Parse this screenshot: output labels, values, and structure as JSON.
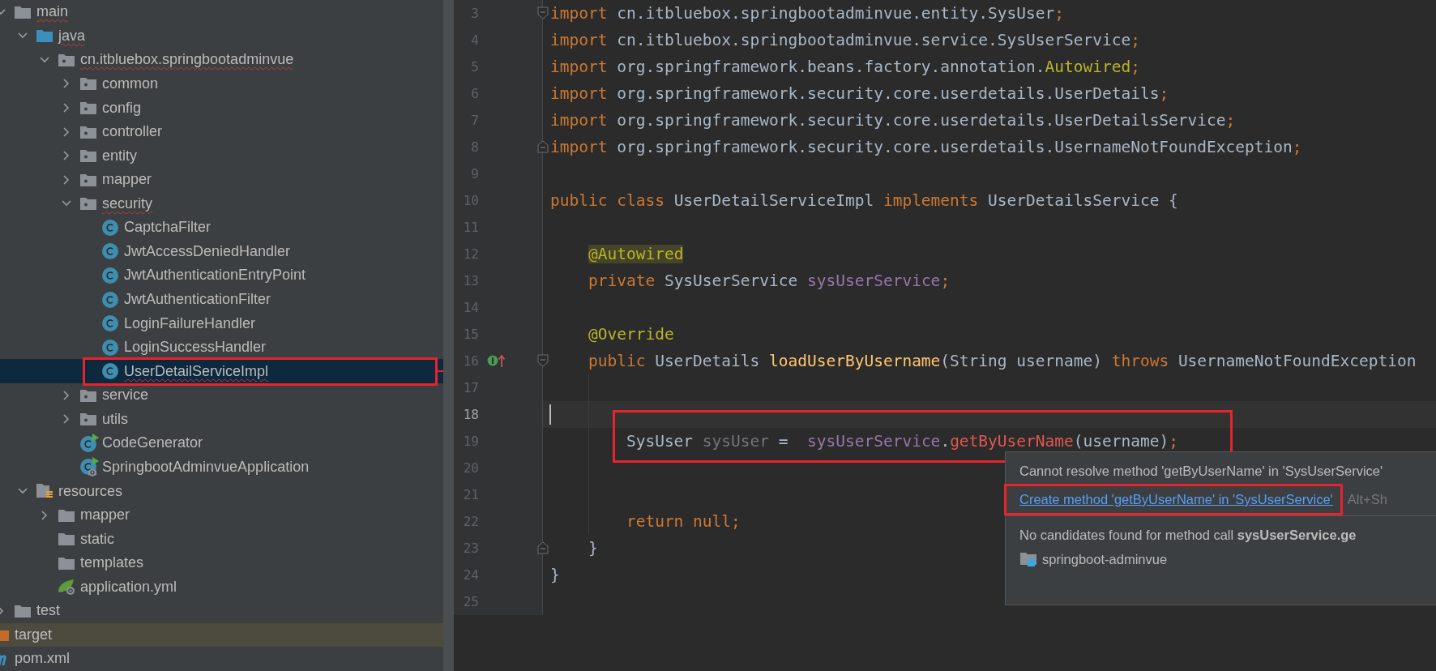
{
  "project_tree": {
    "items": [
      {
        "label": "main",
        "kind": "folder",
        "expanded": true,
        "selected": false,
        "error": true,
        "highlighted": false,
        "children": [
          {
            "label": "java",
            "kind": "source-folder",
            "expanded": true,
            "selected": false,
            "error": true,
            "highlighted": false,
            "children": [
              {
                "label": "cn.itbluebox.springbootadminvue",
                "kind": "package",
                "expanded": true,
                "selected": false,
                "error": true,
                "highlighted": false,
                "children": [
                  {
                    "label": "common",
                    "kind": "package",
                    "expanded": false,
                    "selected": false,
                    "error": false,
                    "highlighted": false
                  },
                  {
                    "label": "config",
                    "kind": "package",
                    "expanded": false,
                    "selected": false,
                    "error": false,
                    "highlighted": false
                  },
                  {
                    "label": "controller",
                    "kind": "package",
                    "expanded": false,
                    "selected": false,
                    "error": false,
                    "highlighted": false
                  },
                  {
                    "label": "entity",
                    "kind": "package",
                    "expanded": false,
                    "selected": false,
                    "error": false,
                    "highlighted": false
                  },
                  {
                    "label": "mapper",
                    "kind": "package",
                    "expanded": false,
                    "selected": false,
                    "error": false,
                    "highlighted": false
                  },
                  {
                    "label": "security",
                    "kind": "package",
                    "expanded": true,
                    "selected": false,
                    "error": true,
                    "highlighted": false,
                    "children": [
                      {
                        "label": "CaptchaFilter",
                        "kind": "class",
                        "selected": false,
                        "error": false,
                        "highlighted": false
                      },
                      {
                        "label": "JwtAccessDeniedHandler",
                        "kind": "class",
                        "selected": false,
                        "error": false,
                        "highlighted": false
                      },
                      {
                        "label": "JwtAuthenticationEntryPoint",
                        "kind": "class",
                        "selected": false,
                        "error": false,
                        "highlighted": false
                      },
                      {
                        "label": "JwtAuthenticationFilter",
                        "kind": "class",
                        "selected": false,
                        "error": false,
                        "highlighted": false
                      },
                      {
                        "label": "LoginFailureHandler",
                        "kind": "class",
                        "selected": false,
                        "error": false,
                        "highlighted": false
                      },
                      {
                        "label": "LoginSuccessHandler",
                        "kind": "class",
                        "selected": false,
                        "error": false,
                        "highlighted": false
                      },
                      {
                        "label": "UserDetailServiceImpl",
                        "kind": "class",
                        "selected": true,
                        "error": true,
                        "highlighted": true
                      }
                    ]
                  },
                  {
                    "label": "service",
                    "kind": "package",
                    "expanded": false,
                    "selected": false,
                    "error": false,
                    "highlighted": false
                  },
                  {
                    "label": "utils",
                    "kind": "package",
                    "expanded": false,
                    "selected": false,
                    "error": false,
                    "highlighted": false
                  },
                  {
                    "label": "CodeGenerator",
                    "kind": "runnable-class",
                    "selected": false,
                    "error": false,
                    "highlighted": false
                  },
                  {
                    "label": "SpringbootAdminvueApplication",
                    "kind": "spring-app",
                    "selected": false,
                    "error": false,
                    "highlighted": false
                  }
                ]
              }
            ]
          },
          {
            "label": "resources",
            "kind": "resources-folder",
            "expanded": true,
            "selected": false,
            "error": false,
            "highlighted": false,
            "children": [
              {
                "label": "mapper",
                "kind": "folder",
                "expanded": false,
                "selected": false,
                "error": false,
                "highlighted": false
              },
              {
                "label": "static",
                "kind": "folder",
                "selected": false,
                "error": false,
                "highlighted": false
              },
              {
                "label": "templates",
                "kind": "folder",
                "selected": false,
                "error": false,
                "highlighted": false
              },
              {
                "label": "application.yml",
                "kind": "spring-config",
                "selected": false,
                "error": false,
                "highlighted": false
              }
            ]
          }
        ]
      },
      {
        "label": "test",
        "kind": "folder",
        "expanded": false,
        "selected": false,
        "error": false,
        "highlighted": false
      }
    ],
    "root_items": [
      {
        "label": "target",
        "kind": "excluded-folder",
        "selected": false,
        "error": false,
        "highlighted": false
      },
      {
        "label": "pom.xml",
        "kind": "maven",
        "selected": false,
        "error": false,
        "highlighted": false
      }
    ]
  },
  "editor": {
    "lines": [
      {
        "number": "3",
        "fold_open": true,
        "current": false,
        "highlighted": false,
        "guide": false,
        "tokens": [
          {
            "kind": "keyword",
            "text": "import"
          },
          {
            "kind": "plain",
            "text": " cn.itbluebox.springbootadminvue.entity.SysUser"
          },
          {
            "kind": "keyword",
            "text": ";"
          }
        ]
      },
      {
        "number": "4",
        "current": false,
        "highlighted": false,
        "guide": false,
        "tokens": [
          {
            "kind": "keyword",
            "text": "import"
          },
          {
            "kind": "plain",
            "text": " cn.itbluebox.springbootadminvue.service.SysUserService"
          },
          {
            "kind": "keyword",
            "text": ";"
          }
        ]
      },
      {
        "number": "5",
        "current": false,
        "highlighted": false,
        "guide": false,
        "tokens": [
          {
            "kind": "keyword",
            "text": "import"
          },
          {
            "kind": "plain",
            "text": " org.springframework.beans.factory.annotation."
          },
          {
            "kind": "annotation",
            "text": "Autowired"
          },
          {
            "kind": "keyword",
            "text": ";"
          }
        ]
      },
      {
        "number": "6",
        "current": false,
        "highlighted": false,
        "guide": false,
        "tokens": [
          {
            "kind": "keyword",
            "text": "import"
          },
          {
            "kind": "plain",
            "text": " org.springframework.security.core.userdetails.UserDetails"
          },
          {
            "kind": "keyword",
            "text": ";"
          }
        ]
      },
      {
        "number": "7",
        "current": false,
        "highlighted": false,
        "guide": false,
        "tokens": [
          {
            "kind": "keyword",
            "text": "import"
          },
          {
            "kind": "plain",
            "text": " org.springframework.security.core.userdetails.UserDetailsService"
          },
          {
            "kind": "keyword",
            "text": ";"
          }
        ]
      },
      {
        "number": "8",
        "fold_close": true,
        "current": false,
        "highlighted": false,
        "guide": false,
        "tokens": [
          {
            "kind": "keyword",
            "text": "import"
          },
          {
            "kind": "plain",
            "text": " org.springframework.security.core.userdetails.UsernameNotFoundException"
          },
          {
            "kind": "keyword",
            "text": ";"
          }
        ]
      },
      {
        "number": "9",
        "current": false,
        "highlighted": false,
        "guide": false
      },
      {
        "number": "10",
        "current": false,
        "highlighted": false,
        "guide": false,
        "tokens": [
          {
            "kind": "keyword",
            "text": "public class "
          },
          {
            "kind": "plain",
            "text": "UserDetailServiceImpl "
          },
          {
            "kind": "keyword",
            "text": "implements "
          },
          {
            "kind": "plain",
            "text": "UserDetailsService {"
          }
        ]
      },
      {
        "number": "11",
        "current": false,
        "highlighted": false,
        "guide": false
      },
      {
        "number": "12",
        "current": false,
        "highlighted": false,
        "guide": false,
        "tokens": [
          {
            "kind": "annotation-marked",
            "text": "    @Autowired"
          }
        ]
      },
      {
        "number": "13",
        "current": false,
        "highlighted": false,
        "guide": false,
        "tokens": [
          {
            "kind": "keyword",
            "text": "    private "
          },
          {
            "kind": "plain",
            "text": "SysUserService "
          },
          {
            "kind": "field",
            "text": "sysUserService"
          },
          {
            "kind": "keyword",
            "text": ";"
          }
        ]
      },
      {
        "number": "14",
        "current": false,
        "highlighted": false,
        "guide": false
      },
      {
        "number": "15",
        "current": false,
        "highlighted": false,
        "guide": false,
        "tokens": [
          {
            "kind": "annotation",
            "text": "    @Override"
          }
        ]
      },
      {
        "number": "16",
        "fold_open": true,
        "override_marker": true,
        "current": false,
        "highlighted": false,
        "guide": false,
        "tokens": [
          {
            "kind": "keyword",
            "text": "    public "
          },
          {
            "kind": "plain",
            "text": "UserDetails "
          },
          {
            "kind": "method",
            "text": "loadUserByUsername"
          },
          {
            "kind": "plain",
            "text": "(String username) "
          },
          {
            "kind": "keyword",
            "text": "throws "
          },
          {
            "kind": "plain",
            "text": "UsernameNotFoundException"
          }
        ]
      },
      {
        "number": "17",
        "current": false,
        "highlighted": false,
        "guide": true
      },
      {
        "number": "18",
        "current": true,
        "highlighted": false,
        "guide": true
      },
      {
        "number": "19",
        "current": false,
        "highlighted": true,
        "guide": true,
        "tokens": [
          {
            "kind": "plain",
            "text": "        SysUser "
          },
          {
            "kind": "unused",
            "text": "sysUser"
          },
          {
            "kind": "plain",
            "text": " =  "
          },
          {
            "kind": "field",
            "text": "sysUserService"
          },
          {
            "kind": "plain",
            "text": "."
          },
          {
            "kind": "error",
            "text": "getByUserName"
          },
          {
            "kind": "plain",
            "text": "(username)"
          },
          {
            "kind": "keyword",
            "text": ";"
          }
        ]
      },
      {
        "number": "20",
        "current": false,
        "highlighted": false,
        "guide": true
      },
      {
        "number": "21",
        "current": false,
        "highlighted": false,
        "guide": true
      },
      {
        "number": "22",
        "current": false,
        "highlighted": false,
        "guide": true,
        "tokens": [
          {
            "kind": "keyword",
            "text": "        return null;"
          }
        ]
      },
      {
        "number": "23",
        "fold_close": true,
        "current": false,
        "highlighted": false,
        "guide": false,
        "tokens": [
          {
            "kind": "plain",
            "text": "    }"
          }
        ]
      },
      {
        "number": "24",
        "current": false,
        "highlighted": false,
        "guide": false,
        "tokens": [
          {
            "kind": "plain",
            "text": "}"
          }
        ]
      },
      {
        "number": "25",
        "current": false,
        "highlighted": false,
        "guide": false
      }
    ]
  },
  "popup": {
    "messages": [
      {
        "kind": "error",
        "text": "Cannot resolve method 'getByUserName' in 'SysUserService'"
      },
      {
        "kind": "action",
        "text": "Create method 'getByUserName' in 'SysUserService'",
        "shortcut": "Alt+Sh",
        "highlighted": true
      }
    ],
    "details": "No candidates found for method call **sysUserService.ge**",
    "module": "springboot-adminvue"
  }
}
